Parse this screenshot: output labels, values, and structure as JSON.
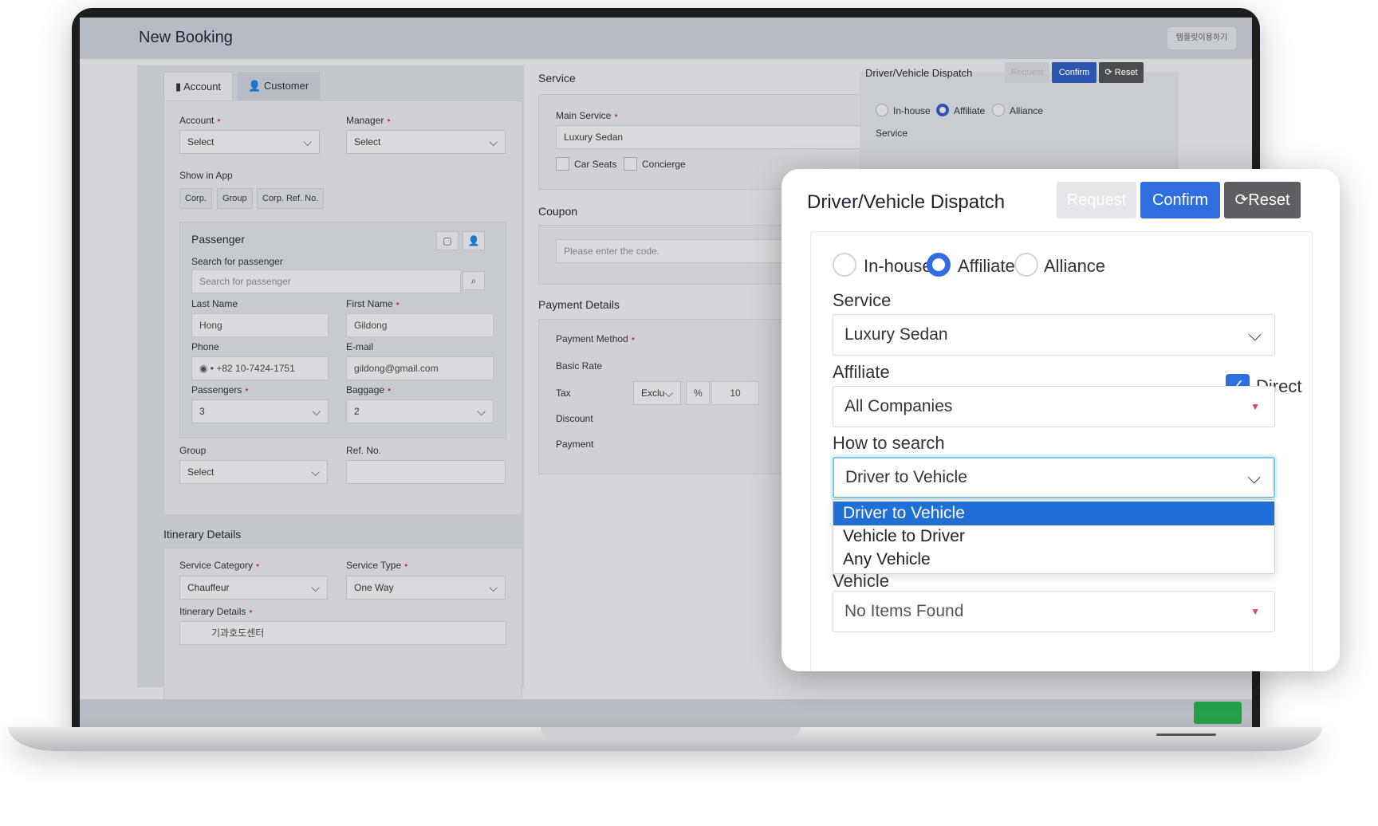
{
  "app": {
    "title": "New Booking",
    "corner_button": "템플릿이용하기"
  },
  "left": {
    "tabs": [
      {
        "label": "Account"
      },
      {
        "label": "Customer"
      }
    ],
    "account_label": "Account",
    "account_value": "Select",
    "manager_label": "Manager",
    "manager_value": "Select",
    "show_in_app_label": "Show in App",
    "show_in_app_chips": [
      "Corp.",
      "Group",
      "Corp. Ref. No."
    ],
    "passenger": {
      "title": "Passenger",
      "search_label": "Search for passenger",
      "search_placeholder": "Search for passenger",
      "last_name_label": "Last Name",
      "last_name": "Hong",
      "first_name_label": "First Name",
      "first_name": "Gildong",
      "phone_label": "Phone",
      "phone": "+82 10-7424-1751",
      "email_label": "E-mail",
      "email": "gildong@gmail.com",
      "passengers_label": "Passengers",
      "passengers": "3",
      "baggage_label": "Baggage",
      "baggage": "2"
    },
    "group_label": "Group",
    "group_value": "Select",
    "ref_label": "Ref. No.",
    "itinerary": {
      "title": "Itinerary Details",
      "service_category_label": "Service Category",
      "service_category": "Chauffeur",
      "service_type_label": "Service Type",
      "service_type": "One Way",
      "details_label": "Itinerary Details",
      "first_stop": "기과호도센터"
    }
  },
  "middle": {
    "service_title": "Service",
    "main_service_label": "Main Service",
    "main_service": "Luxury Sedan",
    "options": [
      "Car Seats",
      "Concierge"
    ],
    "coupon_title": "Coupon",
    "coupon_placeholder": "Please enter the code.",
    "payment_title": "Payment Details",
    "payment_rows": [
      "Payment Method",
      "Basic Rate",
      "Tax",
      "Discount",
      "Payment"
    ],
    "tax_select": "Exclu",
    "tax_unit": "%",
    "tax_value": "10"
  },
  "background_dispatch": {
    "title": "Driver/Vehicle Dispatch",
    "request": "Request",
    "confirm": "Confirm",
    "reset": "Reset",
    "radios": [
      "In-house",
      "Affiliate",
      "Alliance"
    ],
    "service_label": "Service"
  },
  "popup": {
    "title": "Driver/Vehicle Dispatch",
    "request_label": "Request",
    "confirm_label": "Confirm",
    "reset_label": "Reset",
    "radios": [
      {
        "label": "In-house"
      },
      {
        "label": "Affiliate"
      },
      {
        "label": "Alliance"
      }
    ],
    "service_label": "Service",
    "service_value": "Luxury Sedan",
    "affiliate_label": "Affiliate",
    "direct_label": "Direct",
    "affiliate_value": "All Companies",
    "how_label": "How to search",
    "how_value": "Driver to Vehicle",
    "how_options": [
      "Driver to Vehicle",
      "Vehicle to Driver",
      "Any Vehicle"
    ],
    "vehicle_label": "Vehicle",
    "vehicle_value": "No Items Found"
  },
  "colors": {
    "accent": "#2f6ee0",
    "required": "#d53a4a",
    "dropdown_selected": "#1f6fd6"
  }
}
